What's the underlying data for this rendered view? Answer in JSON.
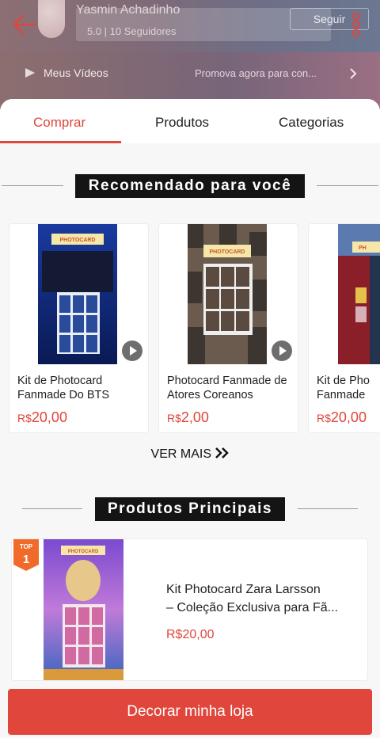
{
  "header": {
    "shop_name": "Yasmin Achadinho",
    "stats": "5.0 | 10 Seguidores",
    "follow_label": "Seguir",
    "videos_label": "Meus Vídeos",
    "promo_label": "Promova agora para con..."
  },
  "tabs": [
    {
      "label": "Comprar",
      "active": true
    },
    {
      "label": "Produtos",
      "active": false
    },
    {
      "label": "Categorias",
      "active": false
    }
  ],
  "recommended": {
    "heading": "Recomendado para você",
    "items": [
      {
        "title_line1": "Kit de Photocard",
        "title_line2": "Fanmade Do BTS",
        "currency": "R$",
        "price": "20,00",
        "image_label": "PHOTOCARD"
      },
      {
        "title_line1": "Photocard Fanmade de",
        "title_line2": "Atores Coreanos",
        "currency": "R$",
        "price": "2,00",
        "image_label": "PHOTOCARD"
      },
      {
        "title_line1": "Kit de Pho",
        "title_line2": "Fanmade",
        "currency": "R$",
        "price": "20,00",
        "image_label": "PH"
      }
    ],
    "see_more": "VER MAIS"
  },
  "main_products": {
    "heading": "Produtos Principais",
    "items": [
      {
        "badge": "TOP",
        "rank": "1",
        "title_line1": "Kit Photocard Zara Larsson",
        "title_line2": "– Coleção Exclusiva para Fã...",
        "price": "R$20,00",
        "image_label": "PHOTOCARD"
      }
    ]
  },
  "cta": {
    "label": "Decorar minha loja"
  },
  "colors": {
    "accent": "#e0463b",
    "heading_bg": "#141414"
  }
}
